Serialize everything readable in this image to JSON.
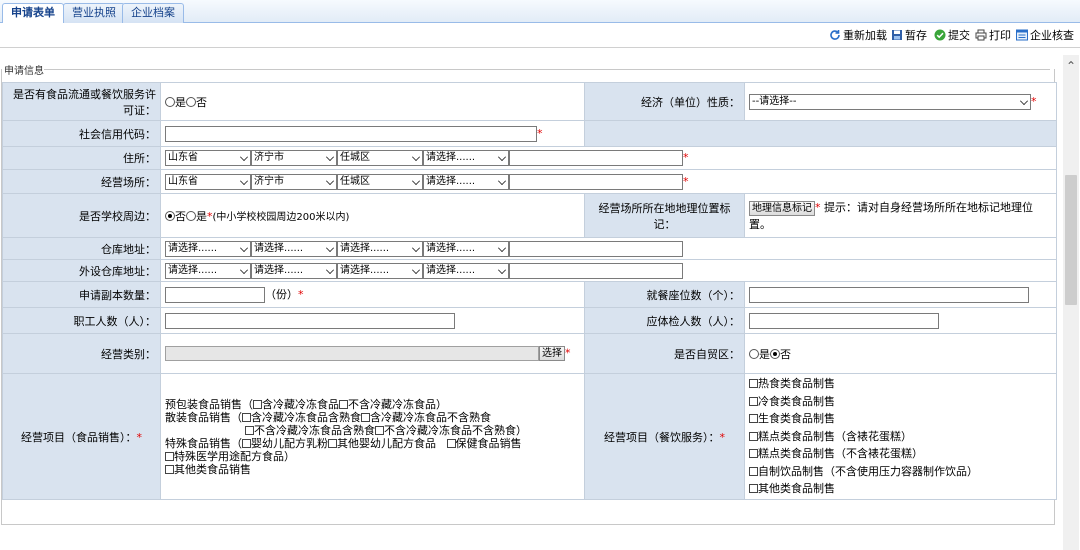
{
  "tabs": [
    {
      "label": "申请表单",
      "active": true
    },
    {
      "label": "营业执照",
      "active": false
    },
    {
      "label": "企业档案",
      "active": false
    }
  ],
  "toolbar": {
    "reload": "重新加载",
    "save": "暂存",
    "submit": "提交",
    "print": "打印",
    "check": "企业核查"
  },
  "section_title": "申请信息",
  "form": {
    "license_label": "是否有食品流通或餐饮服务许可证：",
    "license_yes": "是",
    "license_no": "否",
    "economy_label": "经济（单位）性质：",
    "economy_value": "--请选择--",
    "credit_label": "社会信用代码：",
    "address_label": "住所：",
    "address": {
      "province": "山东省",
      "city": "济宁市",
      "district": "任城区",
      "street": "请选择......"
    },
    "biz_place_label": "经营场所：",
    "biz_place": {
      "province": "山东省",
      "city": "济宁市",
      "district": "任城区",
      "street": "请选择......"
    },
    "school_label": "是否学校周边：",
    "school_no": "否",
    "school_yes": "是",
    "school_note": "(中小学校校园周边200米以内)",
    "geo_label": "经营场所所在地地理位置标记：",
    "geo_button": "地理信息标记",
    "geo_hint": "提示：请对自身经营场所所在地标记地理位置。",
    "warehouse_label": "仓库地址：",
    "warehouse_opts": [
      "请选择......",
      "请选择......",
      "请选择......",
      "请选择......"
    ],
    "ext_warehouse_label": "外设仓库地址：",
    "ext_warehouse_opts": [
      "请选择......",
      "请选择......",
      "请选择......",
      "请选择......"
    ],
    "copies_label": "申请副本数量：",
    "copies_unit": "（份）",
    "seats_label": "就餐座位数（个）：",
    "staff_label": "职工人数（人）：",
    "health_label": "应体检人数（人）：",
    "category_label": "经营类别：",
    "category_select": "选择",
    "ftz_label": "是否自贸区：",
    "ftz_yes": "是",
    "ftz_no": "否",
    "sales_label": "经营项目（食品销售）：",
    "sales_items": {
      "l1_prefix": "预包装食品销售（",
      "l1_a": "含冷藏冷冻食品",
      "l1_b": "不含冷藏冷冻食品）",
      "l2_prefix": "散装食品销售（",
      "l2_a": "含冷藏冷冻食品含熟食",
      "l2_b": "含冷藏冷冻食品不含熟食",
      "l3_a": "不含冷藏冷冻食品含熟食",
      "l3_b": "不含冷藏冷冻食品不含熟食）",
      "l4_prefix": "特殊食品销售（",
      "l4_a": "婴幼儿配方乳粉",
      "l4_b": "其他婴幼儿配方食品",
      "l4_c": "保健食品销售",
      "l5_a": "特殊医学用途配方食品）",
      "l6_a": "其他类食品销售"
    },
    "catering_label": "经营项目（餐饮服务）：",
    "catering_items": [
      "热食类食品制售",
      "冷食类食品制售",
      "生食类食品制售",
      "糕点类食品制售（含裱花蛋糕）",
      "糕点类食品制售（不含裱花蛋糕）",
      "自制饮品制售（不含使用压力容器制作饮品）",
      "其他类食品制售"
    ]
  },
  "colors": {
    "label_bg": "#d9e3ef",
    "border": "#c4cfdc",
    "required": "#e00000",
    "tab_text": "#15428b"
  }
}
